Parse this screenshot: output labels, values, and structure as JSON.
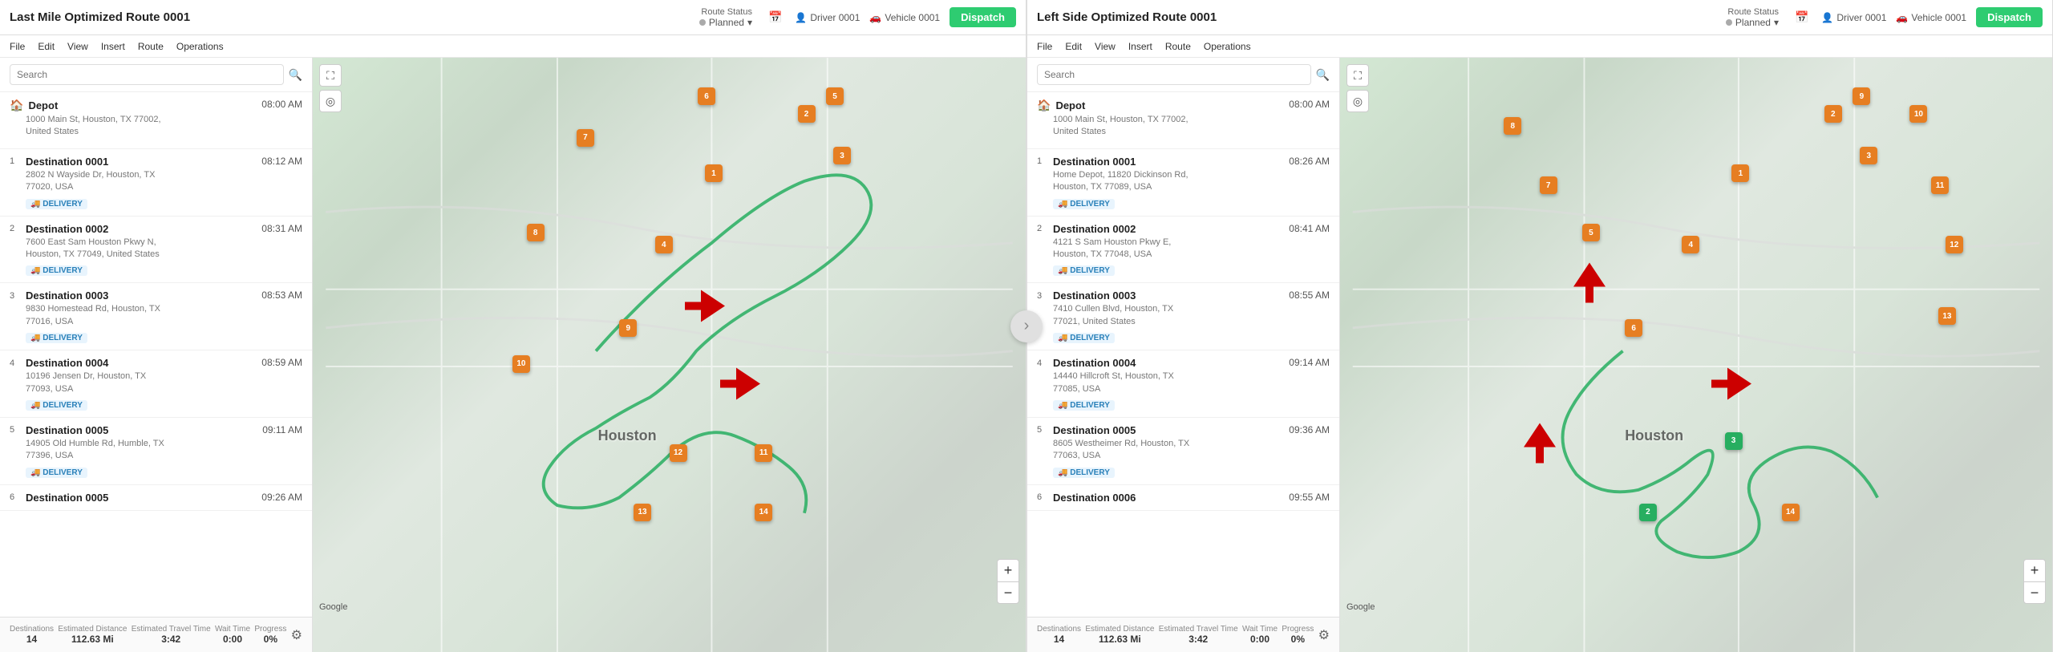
{
  "panels": [
    {
      "id": "left",
      "title": "Last Mile Optimized Route 0001",
      "route_status_label": "Route Status",
      "route_status_value": "Planned",
      "driver": "Driver 0001",
      "vehicle": "Vehicle 0001",
      "dispatch_label": "Dispatch",
      "menu": [
        "File",
        "Edit",
        "View",
        "Insert",
        "Route",
        "Operations"
      ],
      "search_placeholder": "Search",
      "stops": [
        {
          "num": "",
          "is_depot": true,
          "name": "Depot",
          "time": "08:00 AM",
          "address": "1000 Main St, Houston, TX 77002,\nUnited States",
          "badge": null
        },
        {
          "num": "1",
          "is_depot": false,
          "name": "Destination 0001",
          "time": "08:12 AM",
          "address": "2802 N Wayside Dr, Houston, TX\n77020, USA",
          "badge": "DELIVERY"
        },
        {
          "num": "2",
          "is_depot": false,
          "name": "Destination 0002",
          "time": "08:31 AM",
          "address": "7600 East Sam Houston Pkwy N,\nHouston, TX 77049, United States",
          "badge": "DELIVERY"
        },
        {
          "num": "3",
          "is_depot": false,
          "name": "Destination 0003",
          "time": "08:53 AM",
          "address": "9830 Homestead Rd, Houston, TX\n77016, USA",
          "badge": "DELIVERY"
        },
        {
          "num": "4",
          "is_depot": false,
          "name": "Destination 0004",
          "time": "08:59 AM",
          "address": "10196 Jensen Dr, Houston, TX\n77093, USA",
          "badge": "DELIVERY"
        },
        {
          "num": "5",
          "is_depot": false,
          "name": "Destination 0005",
          "time": "09:11 AM",
          "address": "14905 Old Humble Rd, Humble, TX\n77396, USA",
          "badge": "DELIVERY"
        },
        {
          "num": "6",
          "is_depot": false,
          "name": "Destination 0005",
          "time": "09:26 AM",
          "address": "",
          "badge": null
        }
      ],
      "stats": [
        {
          "label": "Destinations",
          "value": "14"
        },
        {
          "label": "Estimated Distance",
          "value": "112.63 Mi"
        },
        {
          "label": "Estimated Travel Time",
          "value": "3:42"
        },
        {
          "label": "Wait Time",
          "value": "0:00"
        },
        {
          "label": "Progress",
          "value": "0%"
        }
      ],
      "markers": [
        {
          "num": "1",
          "x": 62,
          "y": 58,
          "color": "#e67e22"
        },
        {
          "num": "2",
          "x": 68,
          "y": 28,
          "color": "#e67e22"
        },
        {
          "num": "3",
          "x": 71,
          "y": 35,
          "color": "#e67e22"
        },
        {
          "num": "4",
          "x": 50,
          "y": 42,
          "color": "#e67e22"
        },
        {
          "num": "5",
          "x": 73,
          "y": 18,
          "color": "#e67e22"
        },
        {
          "num": "6",
          "x": 55,
          "y": 20,
          "color": "#e67e22"
        },
        {
          "num": "7",
          "x": 39,
          "y": 22,
          "color": "#e67e22"
        },
        {
          "num": "8",
          "x": 32,
          "y": 38,
          "color": "#e67e22"
        },
        {
          "num": "9",
          "x": 43,
          "y": 52,
          "color": "#e67e22"
        },
        {
          "num": "10",
          "x": 30,
          "y": 58,
          "color": "#e67e22"
        },
        {
          "num": "11",
          "x": 63,
          "y": 73,
          "color": "#e67e22"
        },
        {
          "num": "12",
          "x": 52,
          "y": 72,
          "color": "#e67e22"
        },
        {
          "num": "13",
          "x": 47,
          "y": 82,
          "color": "#e67e22"
        },
        {
          "num": "14",
          "x": 63,
          "y": 82,
          "color": "#e67e22"
        }
      ]
    },
    {
      "id": "right",
      "title": "Left Side Optimized Route 0001",
      "route_status_label": "Route Status",
      "route_status_value": "Planned",
      "driver": "Driver 0001",
      "vehicle": "Vehicle 0001",
      "dispatch_label": "Dispatch",
      "menu": [
        "File",
        "Edit",
        "View",
        "Insert",
        "Route",
        "Operations"
      ],
      "search_placeholder": "Search",
      "stops": [
        {
          "num": "",
          "is_depot": true,
          "name": "Depot",
          "time": "08:00 AM",
          "address": "1000 Main St, Houston, TX 77002,\nUnited States",
          "badge": null
        },
        {
          "num": "1",
          "is_depot": false,
          "name": "Destination 0001",
          "time": "08:26 AM",
          "address": "Home Depot, 11820 Dickinson Rd,\nHouston, TX 77089, USA",
          "badge": "DELIVERY"
        },
        {
          "num": "2",
          "is_depot": false,
          "name": "Destination 0002",
          "time": "08:41 AM",
          "address": "4121 S Sam Houston Pkwy E,\nHouston, TX 77048, USA",
          "badge": "DELIVERY"
        },
        {
          "num": "3",
          "is_depot": false,
          "name": "Destination 0003",
          "time": "08:55 AM",
          "address": "7410 Cullen Blvd, Houston, TX\n77021, United States",
          "badge": "DELIVERY"
        },
        {
          "num": "4",
          "is_depot": false,
          "name": "Destination 0004",
          "time": "09:14 AM",
          "address": "14440 Hillcroft St, Houston, TX\n77085, USA",
          "badge": "DELIVERY"
        },
        {
          "num": "5",
          "is_depot": false,
          "name": "Destination 0005",
          "time": "09:36 AM",
          "address": "8605 Westheimer Rd, Houston, TX\n77063, USA",
          "badge": "DELIVERY"
        },
        {
          "num": "6",
          "is_depot": false,
          "name": "Destination 0006",
          "time": "09:55 AM",
          "address": "",
          "badge": null
        }
      ],
      "stats": [
        {
          "label": "Destinations",
          "value": "14"
        },
        {
          "label": "Estimated Distance",
          "value": "112.63 Mi"
        },
        {
          "label": "Estimated Travel Time",
          "value": "3:42"
        },
        {
          "label": "Wait Time",
          "value": "0:00"
        },
        {
          "label": "Progress",
          "value": "0%"
        }
      ],
      "markers": [
        {
          "num": "1",
          "x": 62,
          "y": 58,
          "color": "#e67e22"
        },
        {
          "num": "2",
          "x": 68,
          "y": 28,
          "color": "#e67e22"
        },
        {
          "num": "3",
          "x": 71,
          "y": 35,
          "color": "#e67e22"
        },
        {
          "num": "4",
          "x": 50,
          "y": 42,
          "color": "#e67e22"
        },
        {
          "num": "5",
          "x": 36,
          "y": 38,
          "color": "#e67e22"
        },
        {
          "num": "6",
          "x": 42,
          "y": 55,
          "color": "#e67e22"
        },
        {
          "num": "7",
          "x": 30,
          "y": 30,
          "color": "#e67e22"
        },
        {
          "num": "8",
          "x": 25,
          "y": 22,
          "color": "#e67e22"
        },
        {
          "num": "9",
          "x": 73,
          "y": 18,
          "color": "#e67e22"
        },
        {
          "num": "10",
          "x": 80,
          "y": 22,
          "color": "#e67e22"
        },
        {
          "num": "11",
          "x": 82,
          "y": 35,
          "color": "#e67e22"
        },
        {
          "num": "12",
          "x": 84,
          "y": 42,
          "color": "#e67e22"
        },
        {
          "num": "13",
          "x": 83,
          "y": 52,
          "color": "#e67e22"
        },
        {
          "num": "14",
          "x": 63,
          "y": 82,
          "color": "#e67e22"
        },
        {
          "num": "2",
          "x": 43,
          "y": 82,
          "color": "#27ae60"
        },
        {
          "num": "3",
          "x": 55,
          "y": 72,
          "color": "#27ae60"
        }
      ]
    }
  ],
  "arrow_label": "→"
}
